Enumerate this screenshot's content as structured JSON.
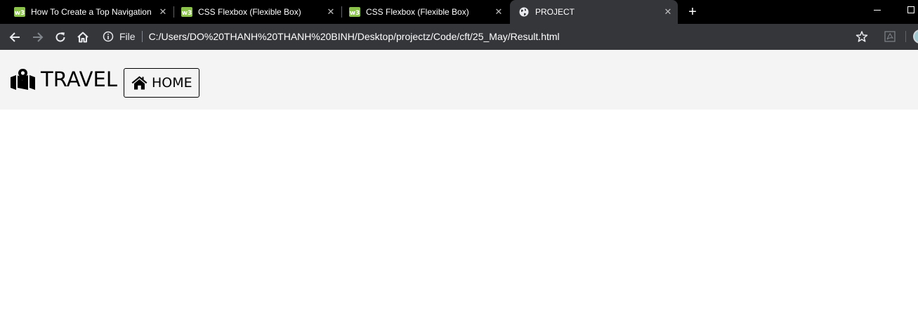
{
  "browser": {
    "tabs": [
      {
        "title": "How To Create a Top Navigation",
        "favicon": "w3schools-icon",
        "active": false
      },
      {
        "title": "CSS Flexbox (Flexible Box)",
        "favicon": "w3schools-icon",
        "active": false
      },
      {
        "title": "CSS Flexbox (Flexible Box)",
        "favicon": "w3schools-icon",
        "active": false
      },
      {
        "title": "PROJECT",
        "favicon": "globe-icon",
        "active": true
      }
    ],
    "close_glyph": "✕",
    "new_tab_glyph": "+",
    "address": {
      "scheme_label": "File",
      "url": "C:/Users/DO%20THANH%20THANH%20BINH/Desktop/projectz/Code/cft/25_May/Result.html"
    }
  },
  "page": {
    "brand": {
      "icon": "map-marked-icon",
      "text": "TRAVEL"
    },
    "home_button": {
      "icon": "home-icon",
      "label": "HOME"
    }
  },
  "colors": {
    "tabstrip": "#000000",
    "toolbar": "#35363a",
    "navbar": "#f4f4f4",
    "w3schools_green": "#8bc34a"
  }
}
